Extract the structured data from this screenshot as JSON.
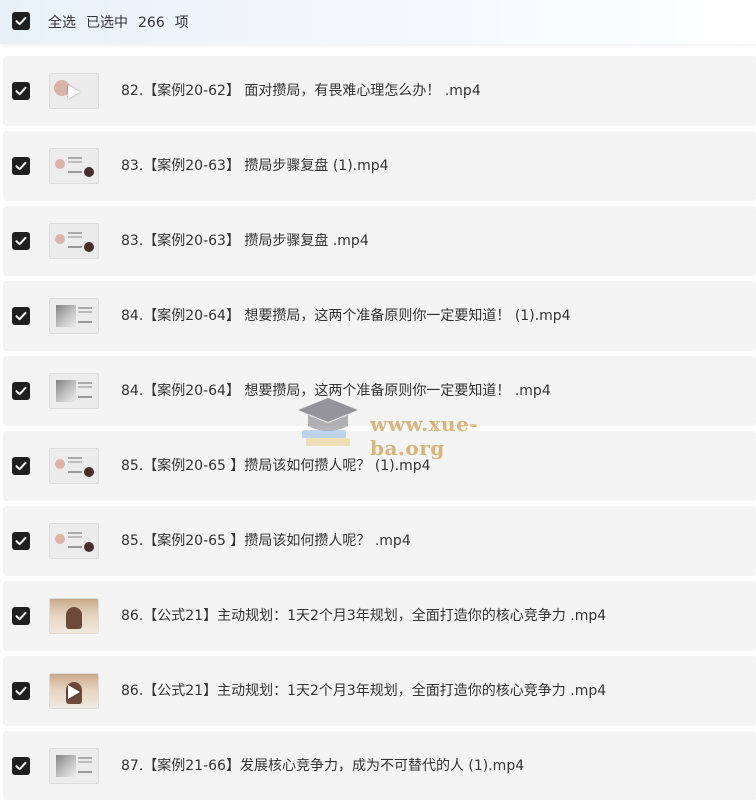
{
  "header": {
    "select_all_label": "全选",
    "selected_label": "已选中",
    "selected_count": "266",
    "count_unit": "项"
  },
  "rows": [
    {
      "title": "82.【案例20-62】 面对攒局，有畏难心理怎么办！ .mp4",
      "thumb": "avatar-play",
      "checked": true
    },
    {
      "title": "83.【案例20-63】 攒局步骤复盘 (1).mp4",
      "thumb": "avatar-text",
      "checked": true
    },
    {
      "title": "83.【案例20-63】 攒局步骤复盘 .mp4",
      "thumb": "avatar-text",
      "checked": true
    },
    {
      "title": "84.【案例20-64】 想要攒局，这两个准备原则你一定要知道！ (1).mp4",
      "thumb": "ink",
      "checked": true
    },
    {
      "title": "84.【案例20-64】 想要攒局，这两个准备原则你一定要知道！ .mp4",
      "thumb": "ink",
      "checked": true
    },
    {
      "title": "85.【案例20-65 】攒局该如何攒人呢？ (1).mp4",
      "thumb": "avatar-text",
      "checked": true
    },
    {
      "title": "85.【案例20-65 】攒局该如何攒人呢？ .mp4",
      "thumb": "avatar-text",
      "checked": true
    },
    {
      "title": "86.【公式21】主动规划：1天2个月3年规划，全面打造你的核心竞争力 .mp4",
      "thumb": "photo",
      "checked": true
    },
    {
      "title": "86.【公式21】主动规划：1天2个月3年规划，全面打造你的核心竞争力 .mp4",
      "thumb": "photo-play",
      "checked": true
    },
    {
      "title": "87.【案例21-66】发展核心竞争力，成为不可替代的人 (1).mp4",
      "thumb": "ink",
      "checked": true
    }
  ],
  "watermark": {
    "text": "www.xue-ba.org",
    "icon": "graduation-cap-icon"
  },
  "colors": {
    "checkbox": "#1f1f1f",
    "row_bg": "#f4f4f4",
    "header_bg": "#e8f1fa",
    "watermark": "#cda05a"
  }
}
